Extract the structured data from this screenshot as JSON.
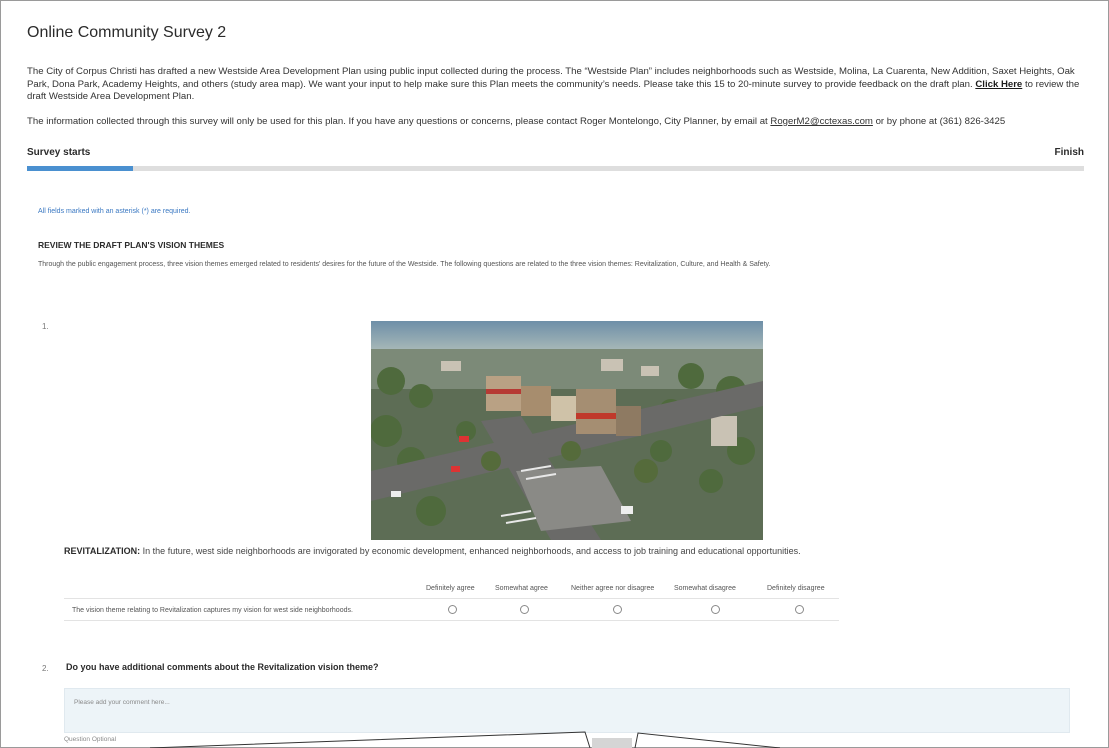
{
  "survey": {
    "title": "Online Community Survey 2",
    "intro_text": "The City of Corpus Christi has drafted a new Westside Area Development Plan using public input collected during the process. The “Westside Plan” includes neighborhoods such as Westside, Molina, La Cuarenta, New Addition, Saxet Heights, Oak Park, Dona Park, Academy Heights, and others (study area map). We want your input to help make sure this Plan meets the community’s needs. Please take this 15 to 20-minute survey to provide feedback on the draft plan.",
    "click_here_label": "Click Here",
    "intro_tail": "to review the draft Westside Area Development Plan.",
    "contact_text": "The information collected through this survey will only be used for this plan.  If you have any questions or concerns, please contact Roger Montelongo, City Planner, by email at",
    "contact_email": "RogerM2@cctexas.com",
    "contact_phone_text": "or by phone at (361) 826-3425"
  },
  "progress": {
    "start_label": "Survey starts",
    "finish_label": "Finish",
    "percent": 10,
    "fill_color": "#4a90d0"
  },
  "required_note": "All fields marked with an asterisk (*) are required.",
  "section": {
    "heading": "REVIEW THE DRAFT PLAN'S VISION THEMES",
    "description": "Through the public engagement process, three vision themes emerged related to residents' desires for the future of the Westside. The following questions are related to the three vision themes: Revitalization, Culture, and Health & Safety."
  },
  "question1": {
    "number": "1.",
    "image_alt": "aerial rendering of redeveloped neighborhood intersection",
    "theme_label": "REVITALIZATION:",
    "theme_text": " In the future, west side neighborhoods are invigorated by economic development, enhanced neighborhoods, and access to job training and educational opportunities.",
    "likert_options": [
      "Definitely agree",
      "Somewhat agree",
      "Neither agree nor disagree",
      "Somewhat disagree",
      "Definitely disagree"
    ],
    "statement": "The vision theme relating to Revitalization captures my vision for west side neighborhoods."
  },
  "question2": {
    "number": "2.",
    "text": "Do you have additional comments about the Revitalization vision theme?",
    "placeholder": "Please add your comment here...",
    "optional_label": "Question Optional"
  }
}
